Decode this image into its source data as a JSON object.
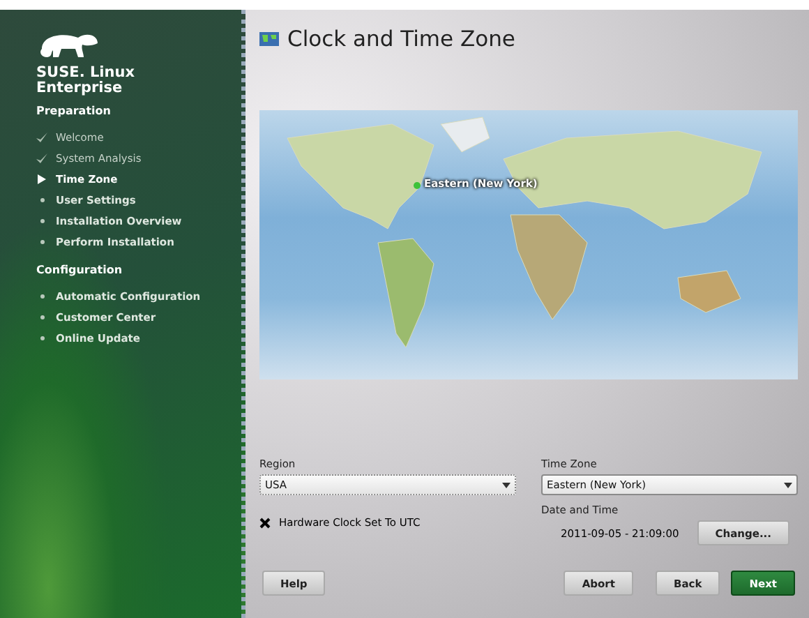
{
  "brand": {
    "line1": "SUSE. Linux",
    "line2": "Enterprise"
  },
  "sections": [
    {
      "title": "Preparation",
      "steps": [
        {
          "label": "Welcome",
          "kind": "done"
        },
        {
          "label": "System Analysis",
          "kind": "done"
        },
        {
          "label": "Time Zone",
          "kind": "current"
        },
        {
          "label": "User Settings",
          "kind": "pending"
        },
        {
          "label": "Installation Overview",
          "kind": "pending"
        },
        {
          "label": "Perform Installation",
          "kind": "pending"
        }
      ]
    },
    {
      "title": "Configuration",
      "steps": [
        {
          "label": "Automatic Configuration",
          "kind": "pending"
        },
        {
          "label": "Customer Center",
          "kind": "pending"
        },
        {
          "label": "Online Update",
          "kind": "pending"
        }
      ]
    }
  ],
  "title": "Clock and Time Zone",
  "map": {
    "marker_label": "Eastern (New York)"
  },
  "region": {
    "label": "Region",
    "value": "USA"
  },
  "time_zone": {
    "label": "Time Zone",
    "value": "Eastern (New York)"
  },
  "hardware_clock": {
    "label": "Hardware Clock Set To UTC",
    "checked": true
  },
  "date_time": {
    "label": "Date and Time",
    "value": "2011-09-05 - 21:09:00",
    "button": "Change..."
  },
  "buttons": {
    "help": "Help",
    "abort": "Abort",
    "back": "Back",
    "next": "Next"
  }
}
